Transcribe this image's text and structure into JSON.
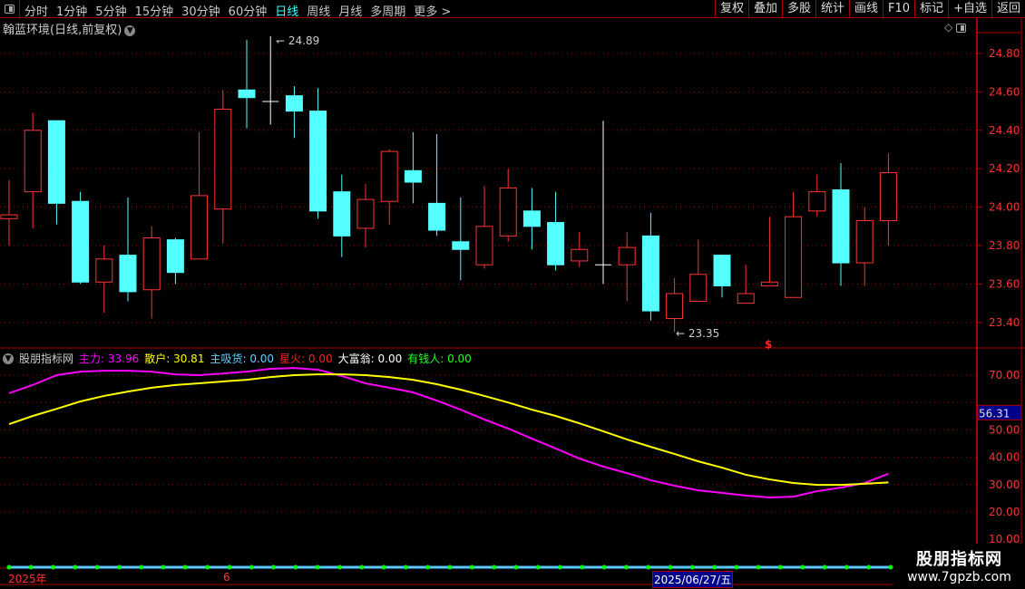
{
  "toolbar": {
    "periods": [
      "分时",
      "1分钟",
      "5分钟",
      "15分钟",
      "30分钟",
      "60分钟",
      "日线",
      "周线",
      "月线",
      "多周期",
      "更多 >"
    ],
    "active_period": "日线",
    "tools": [
      "复权",
      "叠加",
      "多股",
      "统计",
      "画线",
      "F10",
      "标记",
      "+自选",
      "返回"
    ]
  },
  "stock": {
    "title": "翰蓝环境(日线,前复权)",
    "high_marker": "24.89",
    "low_marker": "23.35",
    "signal_marker": "$"
  },
  "price_axis": {
    "labels": [
      "24.80",
      "24.60",
      "24.40",
      "24.20",
      "24.00",
      "23.80",
      "23.60",
      "23.40"
    ]
  },
  "indicator": {
    "name": "股朋指标网",
    "items": [
      {
        "label": "主力:",
        "value": "33.96",
        "color": "#ff00ff"
      },
      {
        "label": "散户:",
        "value": "30.81",
        "color": "#ffff00"
      },
      {
        "label": "主吸货:",
        "value": "0.00",
        "color": "#66ccff"
      },
      {
        "label": "星火:",
        "value": "0.00",
        "color": "#ff2020"
      },
      {
        "label": "大富翁:",
        "value": "0.00",
        "color": "#ffffff"
      },
      {
        "label": "有钱人:",
        "value": "0.00",
        "color": "#20ff20"
      }
    ],
    "axis_labels": [
      "70.00",
      "50.00",
      "40.00",
      "30.00",
      "20.00",
      "10.00"
    ],
    "cursor_value": "56.31"
  },
  "date_axis": {
    "year": "2025年",
    "month": "6",
    "cursor_date": "2025/06/27/五"
  },
  "watermark": {
    "line1": "股朋指标网",
    "line2": "www.7gpzb.com"
  },
  "colors": {
    "up": "#ff3333",
    "down": "#54ffff",
    "doji": "#ffffff",
    "main_force": "#ff00ff",
    "retail": "#ffff00"
  },
  "chart_data": {
    "type": "candlestick",
    "price_range": [
      23.4,
      24.8
    ],
    "candles": [
      [
        23.94,
        24.14,
        23.8,
        23.96
      ],
      [
        24.08,
        24.49,
        23.89,
        24.4
      ],
      [
        24.45,
        24.45,
        23.91,
        24.02
      ],
      [
        24.03,
        24.08,
        23.6,
        23.61
      ],
      [
        23.61,
        23.8,
        23.45,
        23.73
      ],
      [
        23.75,
        24.05,
        23.51,
        23.56
      ],
      [
        23.57,
        23.9,
        23.42,
        23.84
      ],
      [
        23.83,
        23.84,
        23.6,
        23.66
      ],
      [
        23.73,
        24.39,
        23.73,
        24.06
      ],
      [
        23.99,
        24.61,
        23.81,
        24.51
      ],
      [
        24.61,
        24.87,
        24.41,
        24.57
      ],
      [
        24.55,
        24.89,
        24.43,
        24.55
      ],
      [
        24.58,
        24.63,
        24.36,
        24.5
      ],
      [
        24.5,
        24.62,
        23.94,
        23.98
      ],
      [
        24.08,
        24.17,
        23.74,
        23.85
      ],
      [
        23.89,
        24.12,
        23.79,
        24.04
      ],
      [
        24.03,
        24.3,
        23.91,
        24.29
      ],
      [
        24.19,
        24.39,
        24.02,
        24.13
      ],
      [
        24.02,
        24.38,
        23.85,
        23.88
      ],
      [
        23.82,
        24.05,
        23.62,
        23.78
      ],
      [
        23.7,
        24.11,
        23.68,
        23.9
      ],
      [
        23.85,
        24.2,
        23.82,
        24.1
      ],
      [
        23.98,
        24.1,
        23.78,
        23.9
      ],
      [
        23.92,
        24.08,
        23.67,
        23.7
      ],
      [
        23.72,
        23.87,
        23.69,
        23.78
      ],
      [
        23.7,
        24.45,
        23.6,
        23.7
      ],
      [
        23.7,
        23.87,
        23.51,
        23.79
      ],
      [
        23.85,
        23.97,
        23.41,
        23.46
      ],
      [
        23.42,
        23.63,
        23.35,
        23.55
      ],
      [
        23.51,
        23.83,
        23.51,
        23.65
      ],
      [
        23.75,
        23.75,
        23.53,
        23.59
      ],
      [
        23.5,
        23.7,
        23.5,
        23.55
      ],
      [
        23.59,
        23.95,
        23.59,
        23.61
      ],
      [
        23.53,
        24.08,
        23.53,
        23.95
      ],
      [
        23.98,
        24.17,
        23.95,
        24.08
      ],
      [
        24.09,
        24.23,
        23.59,
        23.71
      ],
      [
        23.71,
        24.0,
        23.59,
        23.93
      ],
      [
        23.93,
        24.28,
        23.8,
        24.18
      ]
    ],
    "indicator_range": [
      10,
      75
    ],
    "series": [
      {
        "name": "主力",
        "values": [
          63.4,
          66.4,
          70,
          71.3,
          71.6,
          71.6,
          71.3,
          70.3,
          70,
          70.6,
          71.3,
          72.3,
          72.6,
          72,
          69.7,
          67,
          65.4,
          63.7,
          60.7,
          57.4,
          53.8,
          50.5,
          46.8,
          43.2,
          39.5,
          36.6,
          34.2,
          31.6,
          29.6,
          27.9,
          27,
          26,
          25.3,
          25.6,
          27.6,
          28.9,
          30.6,
          33.96
        ]
      },
      {
        "name": "散户",
        "values": [
          52.1,
          55.1,
          57.7,
          60.4,
          62.4,
          64,
          65.4,
          66.4,
          67,
          67.7,
          68.3,
          69.3,
          70,
          70.3,
          70.3,
          70,
          69.3,
          68.3,
          66.7,
          64.7,
          62.4,
          60,
          57.4,
          55.1,
          52.4,
          49.5,
          46.5,
          43.8,
          41.2,
          38.5,
          36.2,
          33.6,
          31.9,
          30.6,
          29.9,
          29.9,
          30.3,
          30.81
        ]
      }
    ]
  }
}
